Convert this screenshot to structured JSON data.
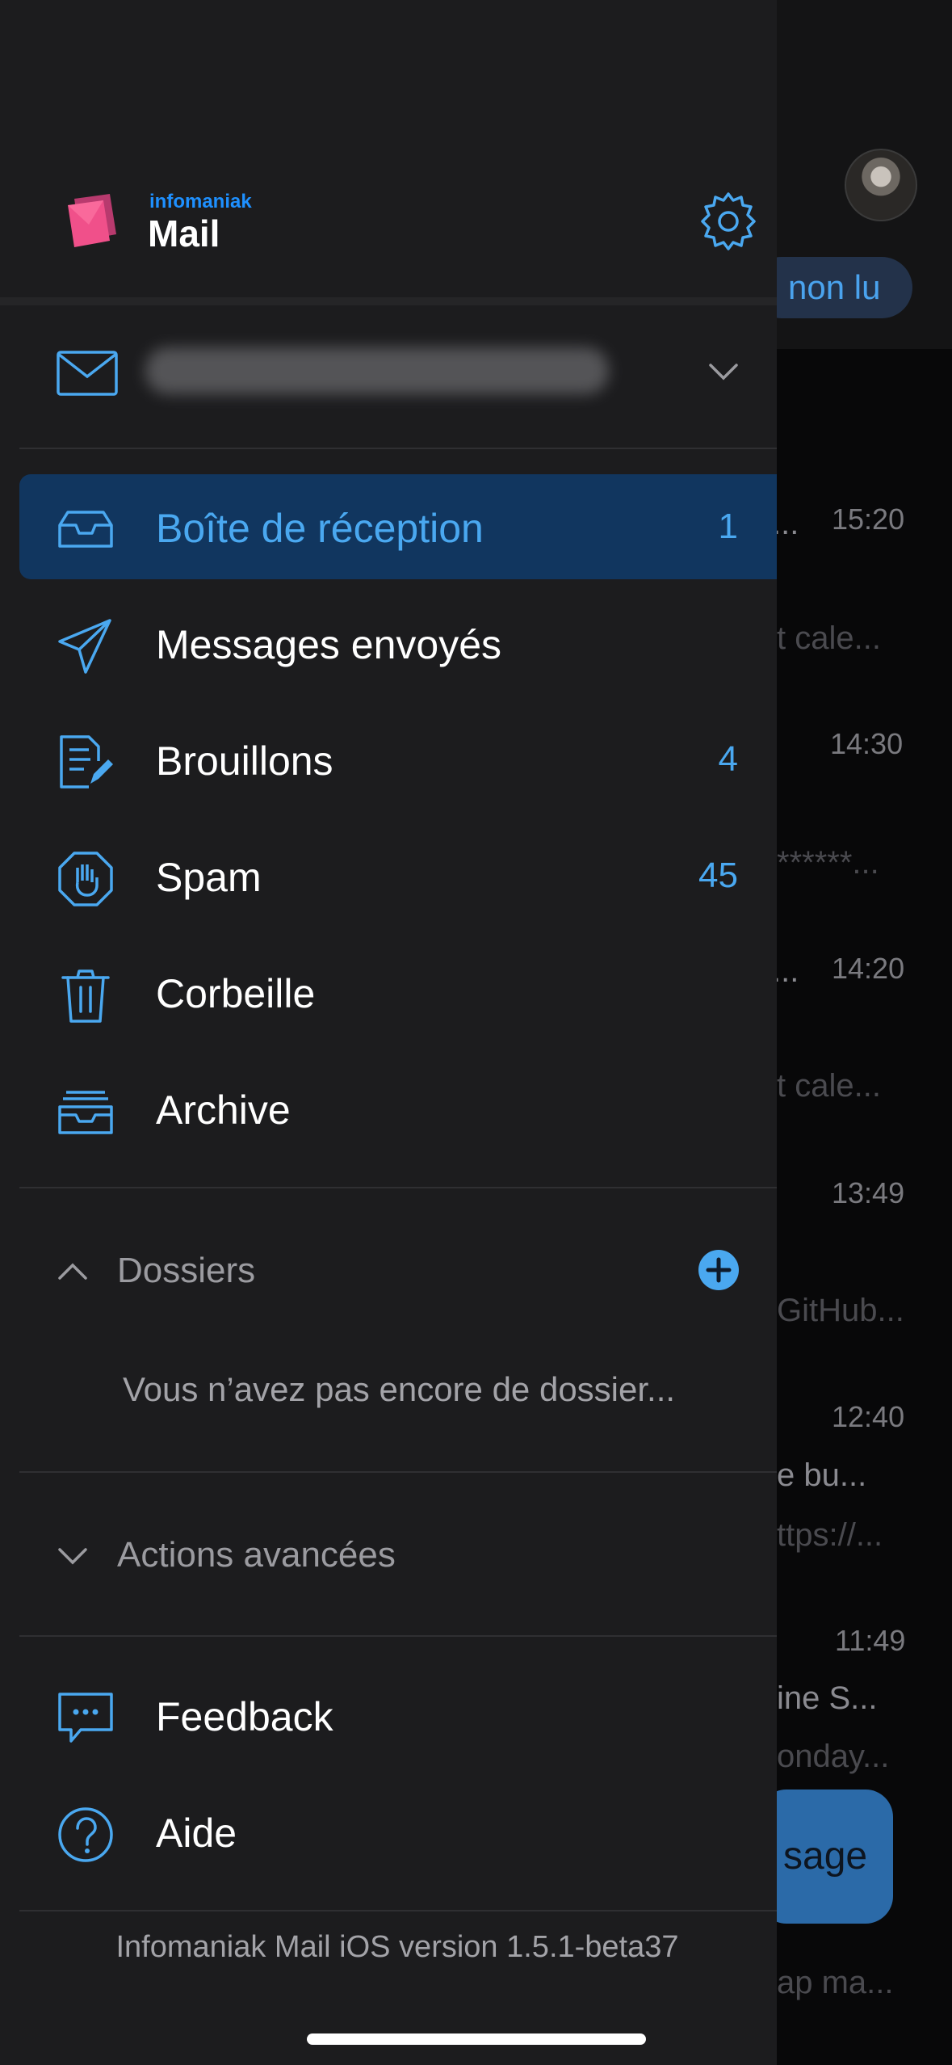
{
  "background_inbox": {
    "filter_chip": "non lu",
    "rows": [
      {
        "time": "15:20",
        "line1": "...",
        "line2": "t cale..."
      },
      {
        "time": "14:30",
        "line1": "",
        "line2": "******..."
      },
      {
        "time": "14:20",
        "line1": "...",
        "line2": "t cale..."
      },
      {
        "time": "13:49",
        "line1": "",
        "line2": "GitHub..."
      },
      {
        "time": "12:40",
        "line1": "e bu...",
        "line2": "ttps://..."
      },
      {
        "time": "11:49",
        "line1": "ine S...",
        "line2": "onday..."
      },
      {
        "time": "",
        "line1": "",
        "line2": "ap ma..."
      }
    ],
    "compose_label": "sage"
  },
  "drawer": {
    "brand": {
      "company": "infomaniak",
      "product": "Mail",
      "logo_icon": "infomaniak-mail-logo",
      "settings_icon": "gear-icon"
    },
    "account": {
      "icon": "envelope-icon",
      "email": "",
      "expand_icon": "chevron-down-icon"
    },
    "folders": [
      {
        "label": "Boîte de réception",
        "count": "1",
        "icon": "inbox-tray-icon",
        "active": true
      },
      {
        "label": "Messages envoyés",
        "count": "",
        "icon": "paper-plane-icon",
        "active": false
      },
      {
        "label": "Brouillons",
        "count": "4",
        "icon": "draft-pencil-icon",
        "active": false
      },
      {
        "label": "Spam",
        "count": "45",
        "icon": "hand-stop-icon",
        "active": false
      },
      {
        "label": "Corbeille",
        "count": "",
        "icon": "trash-icon",
        "active": false
      },
      {
        "label": "Archive",
        "count": "",
        "icon": "archive-icon",
        "active": false
      }
    ],
    "custom_folders": {
      "label": "Dossiers",
      "empty_message": "Vous n’avez pas encore de dossier..."
    },
    "advanced_actions": {
      "label": "Actions avancées"
    },
    "support": [
      {
        "label": "Feedback",
        "icon": "chat-bubble-icon"
      },
      {
        "label": "Aide",
        "icon": "question-circle-icon"
      }
    ],
    "version": "Infomaniak Mail iOS version 1.5.1-beta37"
  },
  "colors": {
    "accent": "#4AA8F0",
    "drawer_bg": "#1C1C1E",
    "active_bg": "#11365F",
    "brand_pink": "#F0508A"
  }
}
